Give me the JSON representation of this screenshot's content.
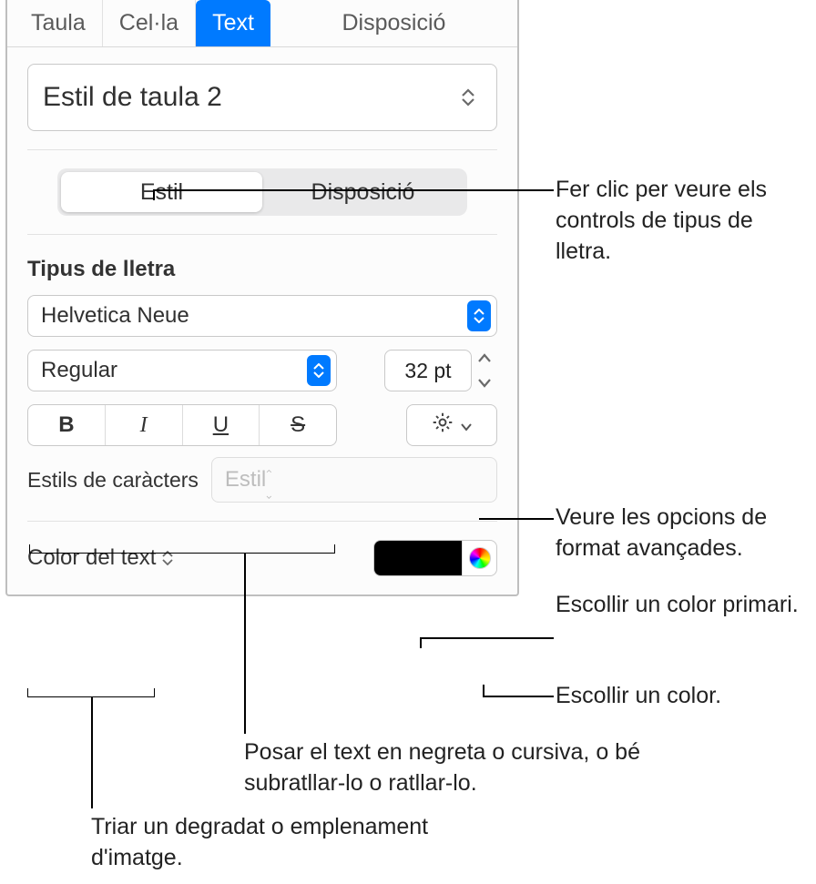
{
  "tabs": {
    "items": [
      "Taula",
      "Cel·la",
      "Text",
      "Disposició"
    ],
    "active_index": 2
  },
  "paragraph_style": {
    "value": "Estil de taula 2"
  },
  "segmented": {
    "items": [
      "Estil",
      "Disposició"
    ],
    "active_index": 0
  },
  "font": {
    "section_label": "Tipus de lletra",
    "family": "Helvetica Neue",
    "typeface": "Regular",
    "size": "32 pt",
    "bius": {
      "bold": "B",
      "italic": "I",
      "underline": "U",
      "strike": "S"
    }
  },
  "character_styles": {
    "label": "Estils de caràcters",
    "placeholder": "Estil"
  },
  "text_color": {
    "label": "Color del text",
    "swatch_hex": "#000000"
  },
  "callouts": {
    "font_controls": "Fer clic per veure els controls de tipus de lletra.",
    "advanced": "Veure les opcions de format avançades.",
    "primary_color": "Escollir un color primari.",
    "pick_color": "Escollir un color.",
    "bius_desc": "Posar el text en negreta o cursiva, o bé subratllar-lo o ratllar-lo.",
    "gradient_fill": "Triar un degradat o emplenament d'imatge."
  }
}
